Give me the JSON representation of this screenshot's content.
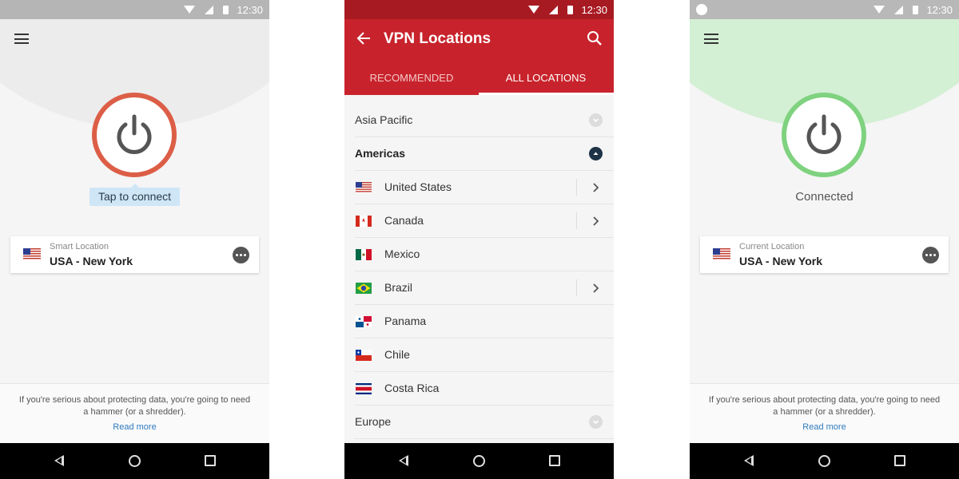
{
  "status_bar": {
    "time": "12:30"
  },
  "screen1": {
    "connect_label": "Tap to connect",
    "location_caption": "Smart Location",
    "location_name": "USA - New York",
    "footer_text": "If you're serious about protecting data, you're going to need a hammer (or a shredder).",
    "footer_link": "Read more",
    "accent_color": "#dc5e47"
  },
  "screen2": {
    "title": "VPN Locations",
    "tabs": [
      {
        "label": "RECOMMENDED",
        "active": false
      },
      {
        "label": "ALL LOCATIONS",
        "active": true
      }
    ],
    "regions": [
      {
        "label": "Asia Pacific",
        "expanded": false
      },
      {
        "label": "Americas",
        "expanded": true
      },
      {
        "label": "Europe",
        "expanded": false
      }
    ],
    "countries": [
      {
        "label": "United States",
        "flag": "us-flag",
        "has_submenu": true
      },
      {
        "label": "Canada",
        "flag": "canada-flag",
        "has_submenu": true
      },
      {
        "label": "Mexico",
        "flag": "mexico-flag",
        "has_submenu": false
      },
      {
        "label": "Brazil",
        "flag": "brazil-flag",
        "has_submenu": true
      },
      {
        "label": "Panama",
        "flag": "panama-flag",
        "has_submenu": false
      },
      {
        "label": "Chile",
        "flag": "chile-flag",
        "has_submenu": false
      },
      {
        "label": "Costa Rica",
        "flag": "costa-rica-flag",
        "has_submenu": false
      }
    ],
    "accent_color": "#c8232c"
  },
  "screen3": {
    "status_label": "Connected",
    "location_caption": "Current Location",
    "location_name": "USA - New York",
    "footer_text": "If you're serious about protecting data, you're going to need a hammer (or a shredder).",
    "footer_link": "Read more",
    "accent_color": "#7fd27f"
  }
}
